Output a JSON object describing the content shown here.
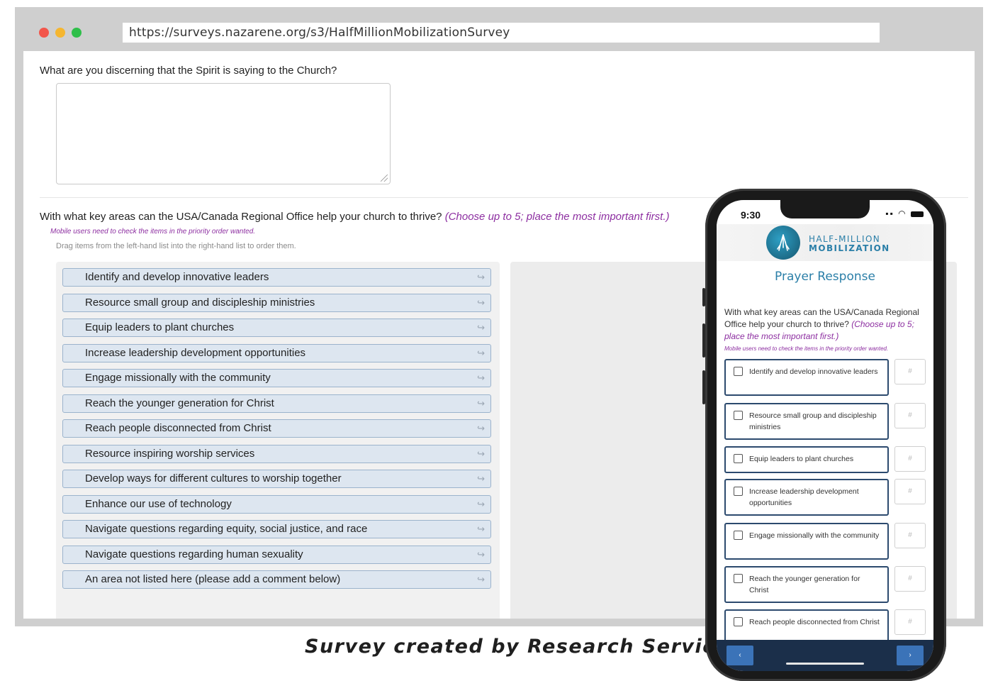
{
  "browser": {
    "url": "https://surveys.nazarene.org/s3/HalfMillionMobilizationSurvey"
  },
  "survey": {
    "question1": "What are you discerning that the Spirit is saying to the Church?",
    "question2": "With what key areas can the USA/Canada Regional Office help your church to thrive?",
    "question2_hint": "(Choose up to 5; place the most important first.)",
    "mobile_note": "Mobile users need to check the items in the priority order wanted.",
    "drag_note": "Drag items from the left-hand list into the right-hand list to order them.",
    "items": [
      "Identify and develop innovative leaders",
      "Resource small group and discipleship ministries",
      "Equip leaders to plant churches",
      "Increase leadership development opportunities",
      "Engage missionally with the community",
      "Reach the younger generation for Christ",
      "Reach people disconnected from Christ",
      "Resource inspiring worship services",
      "Develop ways for different cultures to worship together",
      "Enhance our use of technology",
      "Navigate questions regarding equity, social justice, and race",
      "Navigate questions regarding human sexuality",
      "An area not listed here (please add a comment below)"
    ],
    "item_icon": "share-arrow-icon"
  },
  "caption": "Survey created by Research Services",
  "phone": {
    "time": "9:30",
    "brand_line1": "HALF-MILLION",
    "brand_line2": "MOBILIZATION",
    "title": "Prayer Response",
    "question": "With what key areas can the USA/Canada Regional Office help your church to thrive?",
    "question_hint": "(Choose up to 5; place the most important first.)",
    "note": "Mobile users need to check the items in the priority order wanted.",
    "rank_placeholder": "#",
    "items": [
      "Identify and develop innovative leaders",
      "Resource small group and discipleship ministries",
      "Equip leaders to plant churches",
      "Increase leadership development opportunities",
      "Engage missionally with the community",
      "Reach the younger generation for Christ",
      "Reach people disconnected from Christ"
    ],
    "prev_label": "‹",
    "next_label": "›"
  }
}
